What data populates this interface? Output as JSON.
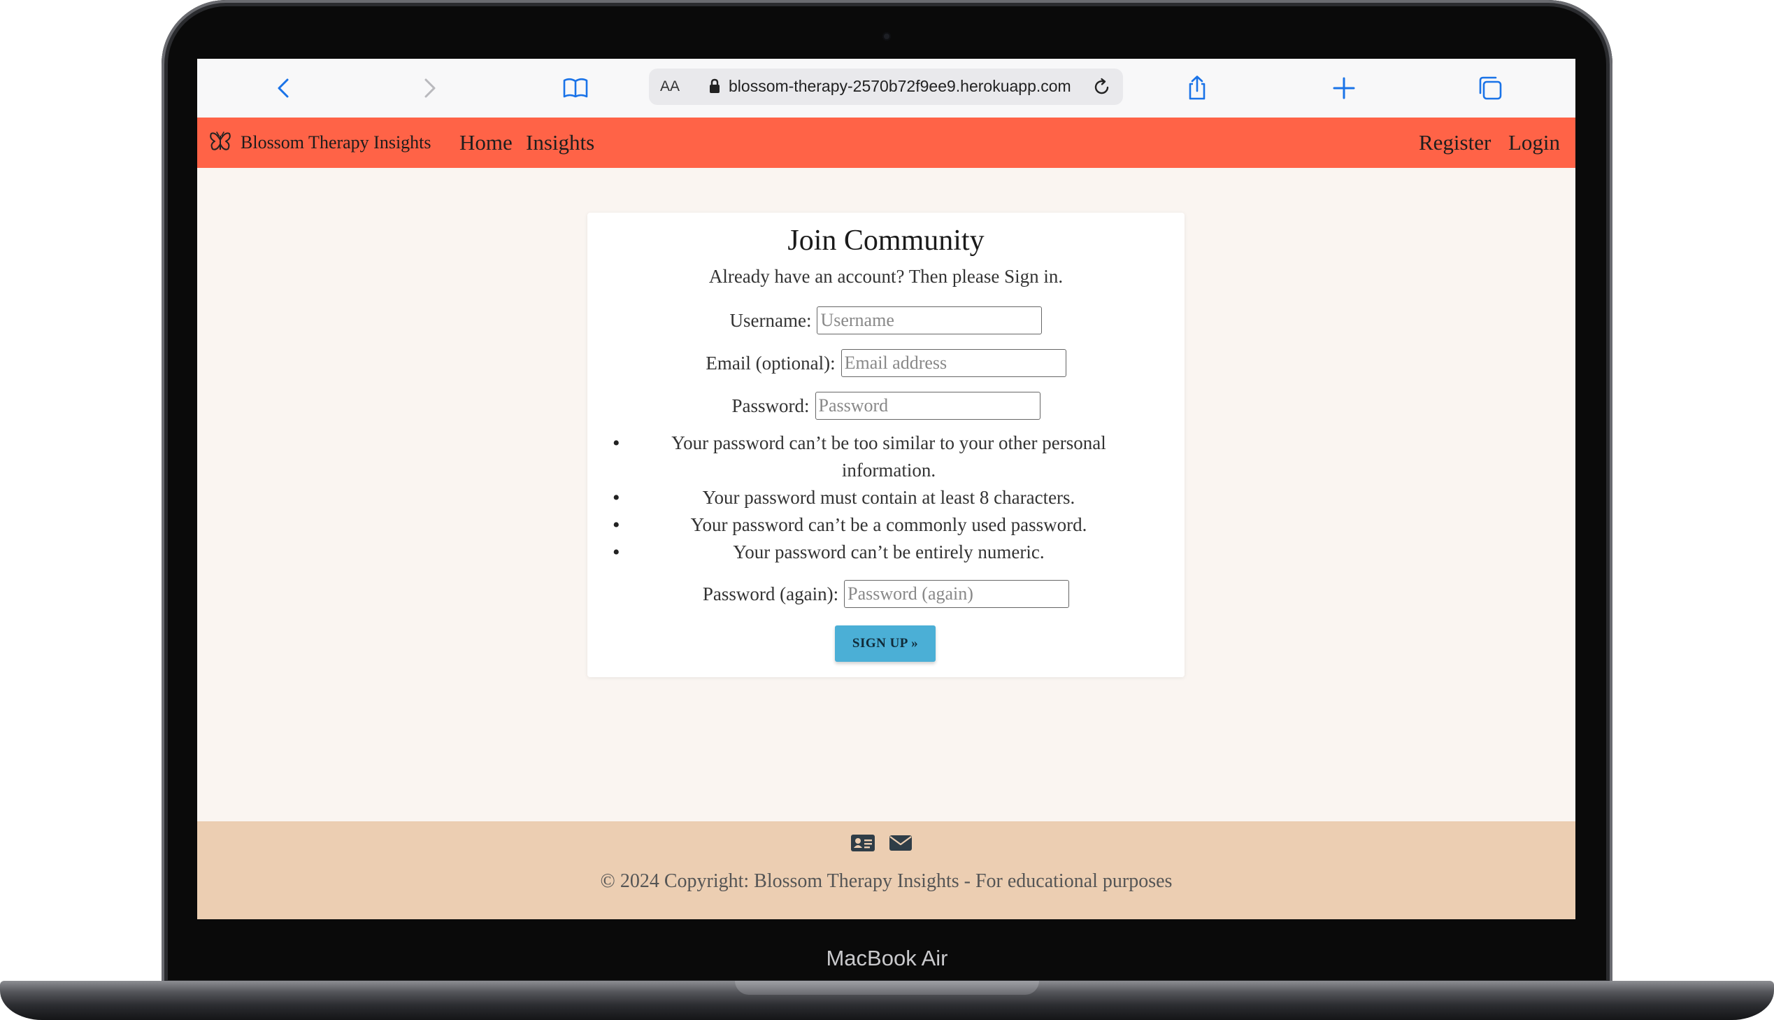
{
  "device": {
    "label": "MacBook Air"
  },
  "browser": {
    "address_bar": {
      "text_size_label": "AA",
      "url": "blossom-therapy-2570b72f9ee9.herokuapp.com"
    },
    "icons": [
      "back-icon",
      "forward-icon",
      "bookmarks-icon",
      "lock-icon",
      "reload-icon",
      "share-icon",
      "new-tab-icon",
      "tabs-icon"
    ]
  },
  "navbar": {
    "brand": "Blossom Therapy Insights",
    "brand_icon": "butterfly-icon",
    "links": {
      "home": "Home",
      "insights": "Insights",
      "register": "Register",
      "login": "Login"
    },
    "background_color": "#ff6347"
  },
  "signup_form": {
    "title": "Join Community",
    "subtitle": "Already have an account? Then please Sign in.",
    "fields": {
      "username": {
        "label": "Username:",
        "placeholder": "Username",
        "value": ""
      },
      "email": {
        "label": "Email (optional):",
        "placeholder": "Email address",
        "value": ""
      },
      "password": {
        "label": "Password:",
        "placeholder": "Password",
        "value": ""
      },
      "password_again": {
        "label": "Password (again):",
        "placeholder": "Password (again)",
        "value": ""
      }
    },
    "password_rules": [
      "Your password can’t be too similar to your other personal information.",
      "Your password must contain at least 8 characters.",
      "Your password can’t be a commonly used password.",
      "Your password can’t be entirely numeric."
    ],
    "bullet": "•",
    "submit_label": "SIGN UP »",
    "submit_color": "#4bafd6"
  },
  "footer": {
    "icons": [
      "contact-card-icon",
      "envelope-icon"
    ],
    "copyright": "© 2024 Copyright: Blossom Therapy Insights - For educational purposes",
    "background_color": "#ecceb2"
  }
}
